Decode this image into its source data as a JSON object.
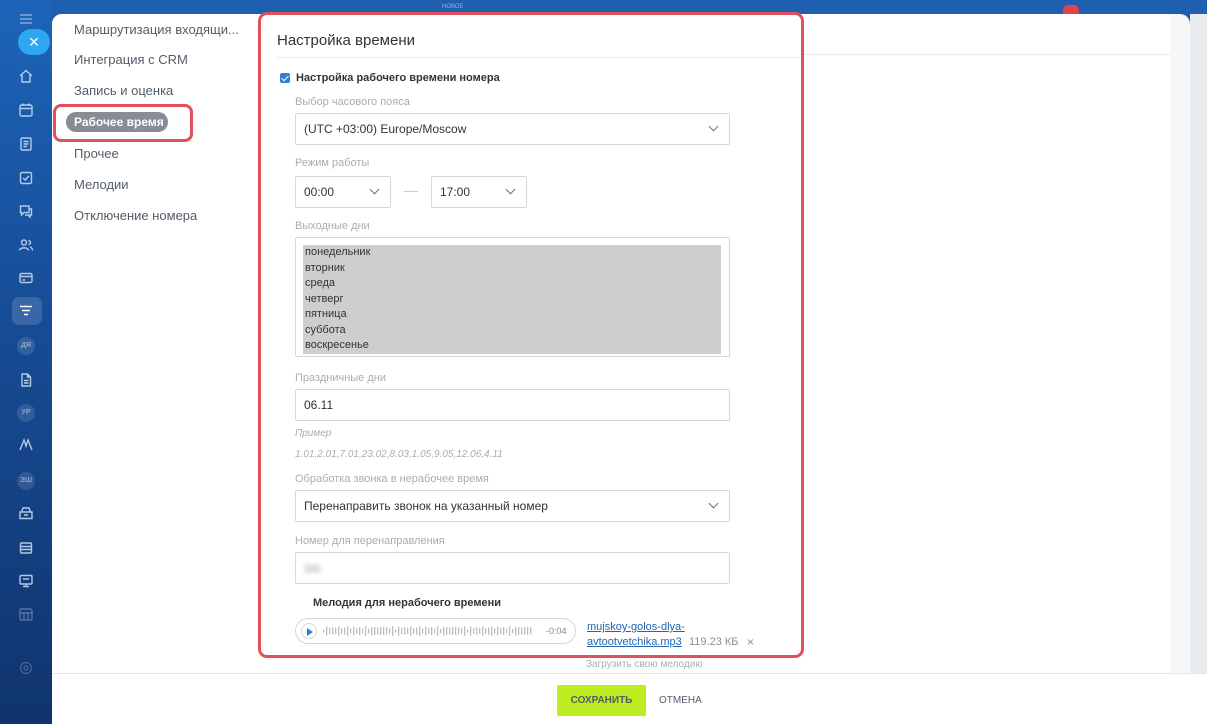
{
  "top": {
    "tag": "НОВОЕ"
  },
  "sidebar": {
    "items": [
      {
        "label": "Маршрутизация входящи..."
      },
      {
        "label": "Интеграция с CRM"
      },
      {
        "label": "Запись и оценка"
      },
      {
        "label": "Рабочее время"
      },
      {
        "label": "Прочее"
      },
      {
        "label": "Мелодии"
      },
      {
        "label": "Отключение номера"
      }
    ],
    "active_index": 3
  },
  "rail": {
    "badges": [
      "ДЯ",
      "УР",
      "ЭШ"
    ]
  },
  "form": {
    "title": "Настройка времени",
    "checkbox_label": "Настройка рабочего времени номера",
    "checkbox_checked": true,
    "timezone": {
      "label": "Выбор часового пояса",
      "value": "(UTC +03:00) Europe/Moscow"
    },
    "work_mode": {
      "label": "Режим работы",
      "from": "00:00",
      "to": "17:00"
    },
    "days_off": {
      "label": "Выходные дни",
      "options": [
        "понедельник",
        "вторник",
        "среда",
        "четверг",
        "пятница",
        "суббота",
        "воскресенье"
      ]
    },
    "holidays": {
      "label": "Праздничные дни",
      "value": "06.11",
      "example_label": "Пример",
      "example_value": "1.01,2.01,7.01,23.02,8.03,1.05,9.05,12.06,4.11"
    },
    "after_hours": {
      "label": "Обработка звонка в нерабочее время",
      "value": "Перенаправить звонок на указанный номер"
    },
    "redirect": {
      "label": "Номер для перенаправления",
      "value": "101"
    },
    "melody": {
      "title": "Мелодия для нерабочего времени",
      "duration": "-0:04",
      "file_line1": "mujskoy-golos-dlya-",
      "file_line2": "avtootvetchika.mp3",
      "file_size": "119.23 КБ",
      "remove": "×",
      "upload_hint": "Загрузить свою мелодию"
    }
  },
  "footer": {
    "save_label": "СОХРАНИТЬ",
    "cancel_label": "ОТМЕНА"
  },
  "colors": {
    "accent": "#2f7fd6",
    "save": "#bbed21",
    "highlight": "#e1515c"
  }
}
